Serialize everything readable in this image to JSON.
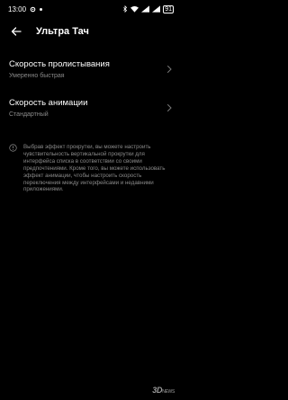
{
  "status_bar": {
    "time": "13:00",
    "battery": "91"
  },
  "header": {
    "title": "Ультра Тач"
  },
  "settings": [
    {
      "title": "Скорость пролистывания",
      "value": "Умеренно быстрая"
    },
    {
      "title": "Скорость анимации",
      "value": "Стандартный"
    }
  ],
  "info": {
    "text": "Выбрав эффект прокрутки, вы можете настроить чувствительность вертикальной прокрутки для интерфейса списка в соответствии со своими предпочтениями. Кроме того, вы можете использовать эффект анимации, чтобы настроить скорость переключения между интерфейсами и недавними приложениями."
  },
  "watermark": {
    "brand": "3D",
    "sub": "NEWS"
  },
  "icons": {
    "back": "arrow-left-icon",
    "chevron": "chevron-right-icon",
    "info": "info-circle-icon"
  },
  "colors": {
    "background": "#000000",
    "text_primary": "#ffffff",
    "text_secondary": "#8a8a8a"
  }
}
